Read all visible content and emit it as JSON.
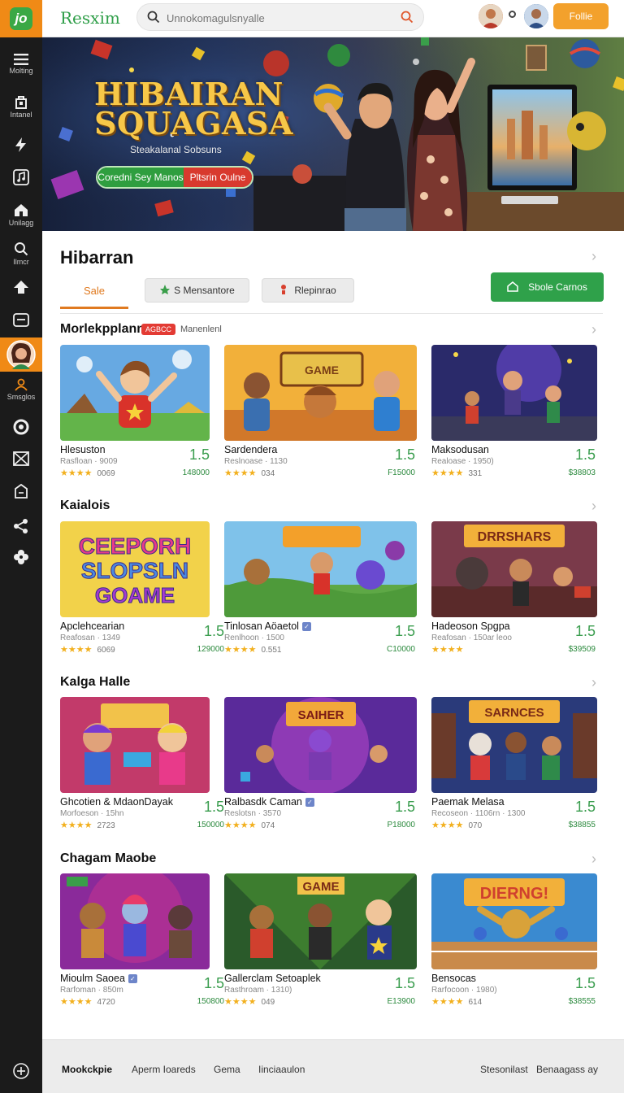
{
  "topbar": {
    "logo_text": "jo",
    "brand": "Resxim",
    "search_placeholder": "Unnokomagulsnyalle",
    "follow_label": "Follie"
  },
  "sidebar": {
    "items": [
      {
        "label": "Molting",
        "icon": "menu-icon"
      },
      {
        "label": "Intanel",
        "icon": "bag-icon"
      },
      {
        "label": "",
        "icon": "bolt-icon"
      },
      {
        "label": "",
        "icon": "music-icon"
      },
      {
        "label": "Unilagg",
        "icon": "home-icon"
      },
      {
        "label": "Ilmcr",
        "icon": "search-icon"
      },
      {
        "label": "",
        "icon": "upload-icon"
      },
      {
        "label": "",
        "icon": "message-icon"
      },
      {
        "label": "",
        "icon": "avatar-icon"
      },
      {
        "label": "Smsglos",
        "icon": "person-icon"
      },
      {
        "label": "",
        "icon": "circle-icon"
      },
      {
        "label": "",
        "icon": "mail-icon"
      },
      {
        "label": "",
        "icon": "box-icon"
      },
      {
        "label": "",
        "icon": "share-icon"
      },
      {
        "label": "",
        "icon": "flower-icon"
      },
      {
        "label": "",
        "icon": "add-icon"
      }
    ]
  },
  "hero": {
    "title_line1": "HIBAIRAN",
    "title_line2": "SQUAGASA",
    "subtitle": "Steakalanal Sobsuns",
    "button_left": "Coredni Sey Manos",
    "button_right": "Pltsrin Oulne"
  },
  "main": {
    "section_title": "Hibarran",
    "tabs": [
      "Sale",
      "S Mensantore",
      "Rlepinrao"
    ],
    "solo_button": "Sbole Carnos"
  },
  "rows": [
    {
      "title": "Morlekpplann",
      "badge": "AGBCC",
      "badge_side": "Manenlenl",
      "cards": [
        {
          "name": "Hlesuston",
          "meta": "Rasfloan · 9009",
          "count": "0069",
          "score": "1.5",
          "price": "148000",
          "verified": false
        },
        {
          "name": "Sardendera",
          "meta": "Reslnoase · 1130",
          "count": "034",
          "score": "1.5",
          "price": "F15000",
          "verified": false
        },
        {
          "name": "Maksodusan",
          "meta": "Realoase · 1950)",
          "count": "331",
          "score": "1.5",
          "price": "$38803",
          "verified": false
        }
      ]
    },
    {
      "title": "Kaialois",
      "cards": [
        {
          "name": "Apclehcearian",
          "meta": "Reafosan · 1349",
          "count": "6069",
          "score": "1.5",
          "price": "129000",
          "verified": false
        },
        {
          "name": "Tinlosan Aöaetol",
          "meta": "Renlhoon · 1500",
          "count": "0.551",
          "score": "1.5",
          "price": "C10000",
          "verified": true
        },
        {
          "name": "Hadeoson Spgpa",
          "meta": "Reafosan · 150ar leoo",
          "count": "",
          "score": "1.5",
          "price": "$39509",
          "verified": false
        }
      ]
    },
    {
      "title": "Kalga Halle",
      "cards": [
        {
          "name": "Ghcotien & MdaonDayak",
          "meta": "Morfoeson · 15hn",
          "count": "2723",
          "score": "1.5",
          "price": "150000",
          "verified": false
        },
        {
          "name": "Ralbasdk Caman",
          "meta": "Reslotsn · 3570",
          "count": "074",
          "score": "1.5",
          "price": "P18000",
          "verified": true
        },
        {
          "name": "Paemak Melasa",
          "meta": "Recoseon · 1106rn · 1300",
          "count": "070",
          "score": "1.5",
          "price": "$38855",
          "verified": false
        }
      ]
    },
    {
      "title": "Chagam Maobe",
      "cards": [
        {
          "name": "Mioulm Saoea",
          "meta": "Rarfoman · 850m",
          "count": "4720",
          "score": "1.5",
          "price": "150800",
          "verified": true
        },
        {
          "name": "Gallerclam Setoaplek",
          "meta": "Rasthroam · 1310)",
          "count": "049",
          "score": "1.5",
          "price": "E13900",
          "verified": false
        },
        {
          "name": "Bensocas",
          "meta": "Rarfocoon · 1980)",
          "count": "614",
          "score": "1.5",
          "price": "$38555",
          "verified": false
        }
      ]
    }
  ],
  "footer": {
    "brand": "Mookckpie",
    "links": [
      "Aperm Ioareds",
      "Gema",
      "Iinciaaulon"
    ],
    "right_links": [
      "Stesonilast",
      "Benaagass ay"
    ]
  },
  "colors": {
    "accent_orange": "#f08a16",
    "brand_green": "#2fa14a",
    "sidebar_bg": "#1b1b1b",
    "star": "#f2b01e"
  }
}
